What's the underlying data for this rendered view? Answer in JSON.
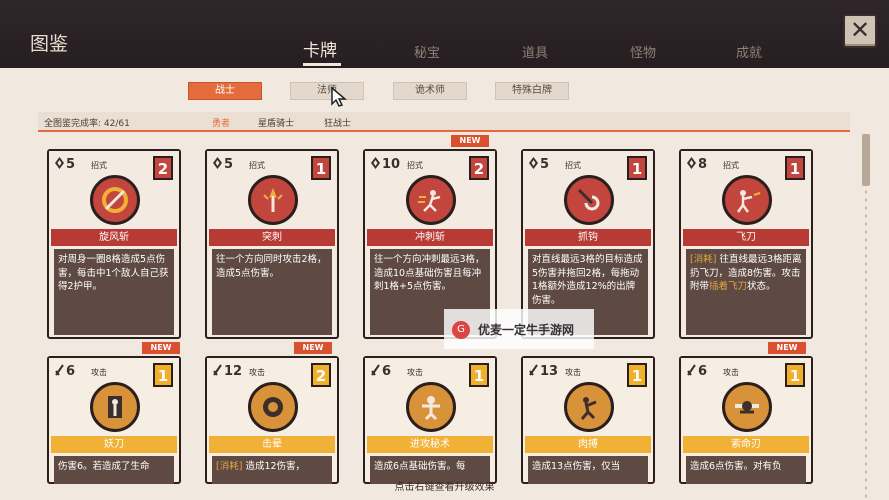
{
  "header": {
    "title": "图鉴",
    "tabs": [
      "卡牌",
      "秘宝",
      "道具",
      "怪物",
      "成就"
    ],
    "close": "✕"
  },
  "class_tabs": [
    "战士",
    "法师",
    "诡术师",
    "特殊白牌"
  ],
  "subbar": {
    "progress": "全图鉴完成率: 42/61",
    "subclasses": [
      "勇者",
      "星盾骑士",
      "狂战士"
    ]
  },
  "cards": [
    {
      "cost": "5",
      "type": "招式",
      "count": "2",
      "name": "旋风斩",
      "desc": "对周身一圈8格造成5点伤害，每击中1个敌人自己获得2护甲。",
      "new": false
    },
    {
      "cost": "5",
      "type": "招式",
      "count": "1",
      "name": "突刺",
      "desc": "往一个方向同时攻击2格，造成5点伤害。",
      "new": false
    },
    {
      "cost": "10",
      "type": "招式",
      "count": "2",
      "name": "冲刺斩",
      "desc": "往一个方向冲刺最远3格，造成10点基础伤害且每冲刺1格+5点伤害。",
      "new": true
    },
    {
      "cost": "5",
      "type": "招式",
      "count": "1",
      "name": "抓钩",
      "desc": "对直线最远3格的目标造成5伤害并拖回2格，每拖动1格额外造成12%的出牌伤害。",
      "new": false
    },
    {
      "cost": "8",
      "type": "招式",
      "count": "1",
      "name": "飞刀",
      "desc_parts": [
        [
          "[消耗]",
          true
        ],
        [
          " 往直线最远3格距离扔飞刀，造成8伤害。攻击附带",
          false
        ],
        [
          "插着飞刀",
          true
        ],
        [
          "状态。",
          false
        ]
      ],
      "new": false
    },
    {
      "cost": "6",
      "type": "攻击",
      "count": "1",
      "name": "妖刀",
      "desc": "伤害6。若造成了生命",
      "new": true
    },
    {
      "cost": "12",
      "type": "攻击",
      "count": "2",
      "name": "击晕",
      "desc_parts": [
        [
          "[消耗]",
          true
        ],
        [
          " 造成12伤害，",
          false
        ]
      ],
      "new": true
    },
    {
      "cost": "6",
      "type": "攻击",
      "count": "1",
      "name": "进攻秘术",
      "desc": "造成6点基础伤害。每",
      "new": false
    },
    {
      "cost": "13",
      "type": "攻击",
      "count": "1",
      "name": "肉搏",
      "desc": "造成13点伤害，仅当",
      "new": false
    },
    {
      "cost": "6",
      "type": "攻击",
      "count": "1",
      "name": "索命刃",
      "desc": "造成6点伤害。对有负",
      "new": true
    }
  ],
  "badge_new": "NEW",
  "footer": "点击右键查看升级效果",
  "watermark": {
    "icon": "G",
    "text": "优麦一定牛手游网"
  },
  "colors": {
    "accent": "#e46c3c",
    "red_card": "#c2463e",
    "gold_card": "#f1b02c",
    "header_bg": "#2b2224",
    "panel_bg": "#f1e9df"
  }
}
